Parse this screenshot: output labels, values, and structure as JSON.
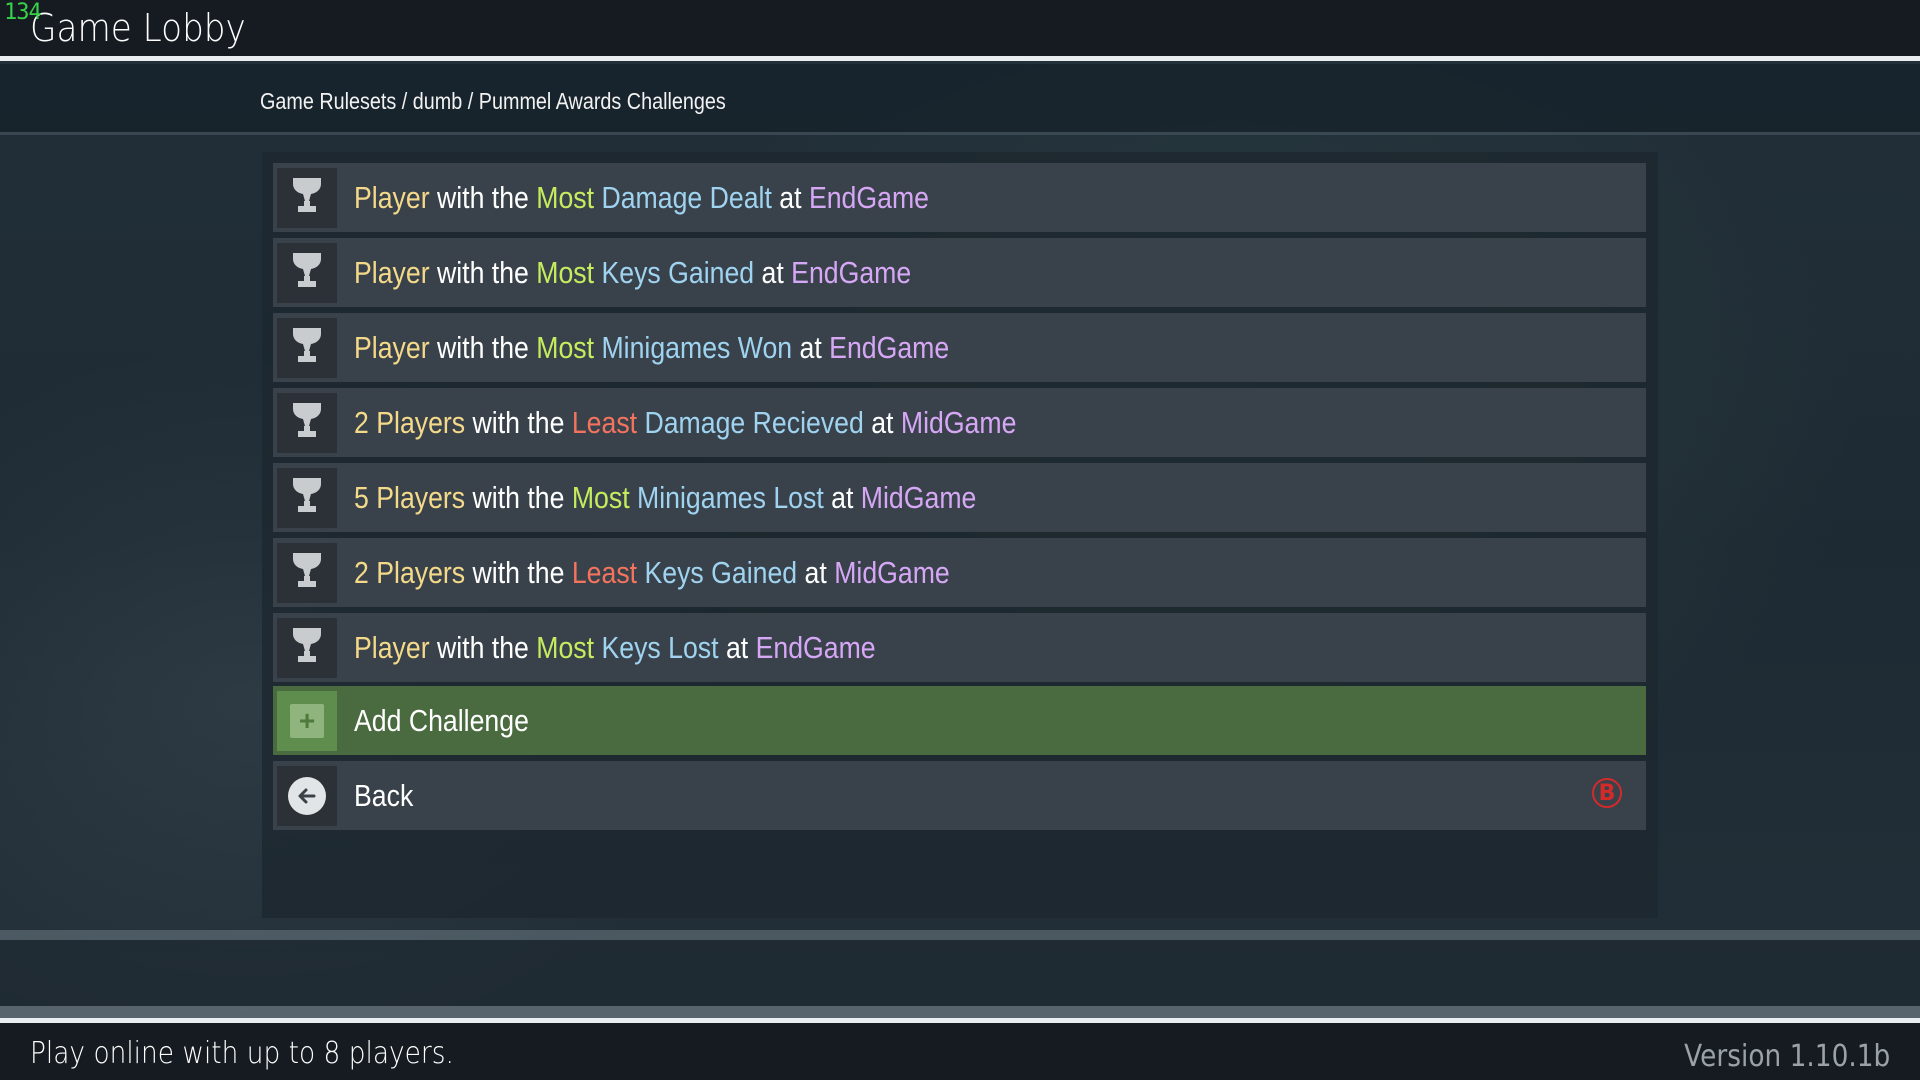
{
  "overlay": {
    "fps": "134"
  },
  "app": {
    "title": "Game Lobby"
  },
  "breadcrumb": "Game Rulesets / dumb / Pummel Awards Challenges",
  "colors": {
    "player": "#f4d98a",
    "most": "#c5ec5e",
    "least": "#f2735e",
    "stat": "#9fd3f0",
    "time": "#d6a7f5",
    "add_row": "#4a6a3f",
    "back_button_badge": "#d42a2a"
  },
  "challenges": [
    {
      "icon": "trophy-icon",
      "parts": [
        {
          "t": "Player",
          "c": "player"
        },
        {
          "t": " with the ",
          "c": "white"
        },
        {
          "t": "Most",
          "c": "most"
        },
        {
          "t": " ",
          "c": "white"
        },
        {
          "t": "Damage Dealt",
          "c": "stat"
        },
        {
          "t": " at ",
          "c": "white"
        },
        {
          "t": "EndGame",
          "c": "time"
        }
      ]
    },
    {
      "icon": "trophy-icon",
      "parts": [
        {
          "t": "Player",
          "c": "player"
        },
        {
          "t": " with the ",
          "c": "white"
        },
        {
          "t": "Most",
          "c": "most"
        },
        {
          "t": " ",
          "c": "white"
        },
        {
          "t": "Keys Gained",
          "c": "stat"
        },
        {
          "t": " at ",
          "c": "white"
        },
        {
          "t": "EndGame",
          "c": "time"
        }
      ]
    },
    {
      "icon": "trophy-icon",
      "parts": [
        {
          "t": "Player",
          "c": "player"
        },
        {
          "t": " with the ",
          "c": "white"
        },
        {
          "t": "Most",
          "c": "most"
        },
        {
          "t": " ",
          "c": "white"
        },
        {
          "t": "Minigames Won",
          "c": "stat"
        },
        {
          "t": " at ",
          "c": "white"
        },
        {
          "t": "EndGame",
          "c": "time"
        }
      ]
    },
    {
      "icon": "trophy-icon",
      "parts": [
        {
          "t": "2 Players",
          "c": "player"
        },
        {
          "t": " with the ",
          "c": "white"
        },
        {
          "t": "Least",
          "c": "least"
        },
        {
          "t": " ",
          "c": "white"
        },
        {
          "t": "Damage Recieved",
          "c": "stat"
        },
        {
          "t": " at ",
          "c": "white"
        },
        {
          "t": "MidGame",
          "c": "time"
        }
      ]
    },
    {
      "icon": "trophy-icon",
      "parts": [
        {
          "t": "5 Players",
          "c": "player"
        },
        {
          "t": " with the ",
          "c": "white"
        },
        {
          "t": "Most",
          "c": "most"
        },
        {
          "t": " ",
          "c": "white"
        },
        {
          "t": "Minigames Lost",
          "c": "stat"
        },
        {
          "t": " at ",
          "c": "white"
        },
        {
          "t": "MidGame",
          "c": "time"
        }
      ]
    },
    {
      "icon": "trophy-icon",
      "parts": [
        {
          "t": "2 Players",
          "c": "player"
        },
        {
          "t": " with the ",
          "c": "white"
        },
        {
          "t": "Least",
          "c": "least"
        },
        {
          "t": " ",
          "c": "white"
        },
        {
          "t": "Keys Gained",
          "c": "stat"
        },
        {
          "t": " at ",
          "c": "white"
        },
        {
          "t": "MidGame",
          "c": "time"
        }
      ]
    },
    {
      "icon": "trophy-icon",
      "parts": [
        {
          "t": "Player",
          "c": "player"
        },
        {
          "t": " with the ",
          "c": "white"
        },
        {
          "t": "Most",
          "c": "most"
        },
        {
          "t": " ",
          "c": "white"
        },
        {
          "t": "Keys Lost",
          "c": "stat"
        },
        {
          "t": " at ",
          "c": "white"
        },
        {
          "t": "EndGame",
          "c": "time"
        }
      ]
    }
  ],
  "actions": {
    "add_label": "Add Challenge",
    "add_icon": "plus-icon",
    "add_glyph": "+",
    "back_label": "Back",
    "back_icon": "arrow-left-icon",
    "back_hint": "B",
    "back_hint_icon": "b-button-icon"
  },
  "footer": {
    "tagline": "Play online with up to 8 players.",
    "version": "Version 1.10.1b"
  }
}
